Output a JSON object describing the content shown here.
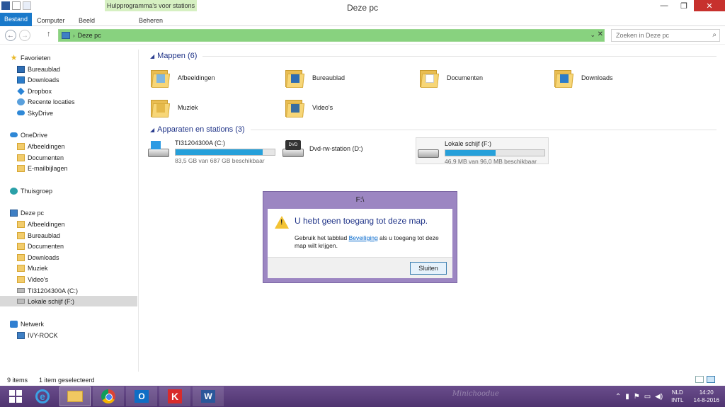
{
  "window": {
    "title": "Deze pc",
    "context_tab_header": "Hulpprogramma's voor stations",
    "controls": {
      "minimize": "—",
      "maximize": "❐",
      "close": "✕"
    }
  },
  "ribbon": {
    "tabs": [
      "Bestand",
      "Computer",
      "Beeld",
      "Beheren"
    ]
  },
  "address": {
    "path": "Deze pc",
    "search_placeholder": "Zoeken in Deze pc"
  },
  "sidebar": {
    "favorites": {
      "label": "Favorieten",
      "items": [
        "Bureaublad",
        "Downloads",
        "Dropbox",
        "Recente locaties",
        "SkyDrive"
      ]
    },
    "onedrive": {
      "label": "OneDrive",
      "items": [
        "Afbeeldingen",
        "Documenten",
        "E-mailbijlagen"
      ]
    },
    "homegroup": "Thuisgroep",
    "thispc": {
      "label": "Deze pc",
      "items": [
        "Afbeeldingen",
        "Bureaublad",
        "Documenten",
        "Downloads",
        "Muziek",
        "Video's",
        "TI31204300A (C:)",
        "Lokale schijf (F:)"
      ]
    },
    "network": {
      "label": "Netwerk",
      "items": [
        "IVY-ROCK"
      ]
    }
  },
  "folders": {
    "header": "Mappen (6)",
    "items": [
      "Afbeeldingen",
      "Bureaublad",
      "Documenten",
      "Downloads",
      "Muziek",
      "Video's"
    ]
  },
  "devices": {
    "header": "Apparaten en stations (3)",
    "items": [
      {
        "name": "TI31204300A (C:)",
        "free": "83,5 GB van 687 GB beschikbaar",
        "used_fraction": 0.88
      },
      {
        "name": "Dvd-rw-station (D:)",
        "badge": "DVD"
      },
      {
        "name": "Lokale schijf (F:)",
        "free": "46,9 MB van 96,0 MB beschikbaar",
        "used_fraction": 0.51
      }
    ]
  },
  "dialog": {
    "title": "F:\\",
    "heading": "U hebt geen toegang tot deze map.",
    "message_pre": "Gebruik het tabblad ",
    "message_link": "Beveiliging",
    "message_post": " als u toegang tot deze map wilt krijgen.",
    "button": "Sluiten"
  },
  "status": {
    "count": "9 items",
    "selected": "1 item geselecteerd"
  },
  "taskbar": {
    "watermark": "Minichoodue",
    "lang_top": "NLD",
    "lang_bottom": "INTL",
    "time": "14:20",
    "date": "14-8-2016"
  }
}
